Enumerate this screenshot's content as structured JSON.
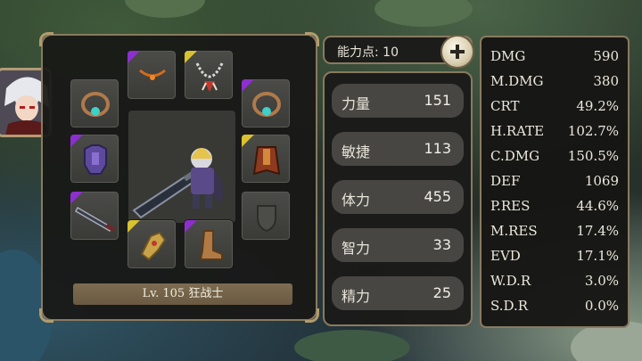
{
  "stat_points": {
    "label": "能力点: 10"
  },
  "equipment": {
    "level_label": "Lv. 105 狂战士",
    "slots": [
      {
        "id": "necklace-orange",
        "rarity": "purple",
        "icon": "amulet-icon"
      },
      {
        "id": "necklace-chain",
        "rarity": "yellow",
        "icon": "necklace-icon"
      },
      {
        "id": "earring-left",
        "rarity": "none",
        "icon": "earring-icon"
      },
      {
        "id": "earring-right",
        "rarity": "purple",
        "icon": "earring-icon"
      },
      {
        "id": "armor",
        "rarity": "purple",
        "icon": "armor-icon"
      },
      {
        "id": "cloak",
        "rarity": "yellow",
        "icon": "cloak-icon"
      },
      {
        "id": "weapon",
        "rarity": "purple",
        "icon": "sword-icon"
      },
      {
        "id": "offhand-empty",
        "rarity": "none",
        "icon": "shield-placeholder-icon"
      },
      {
        "id": "gloves",
        "rarity": "yellow",
        "icon": "gauntlet-icon"
      },
      {
        "id": "boots",
        "rarity": "purple",
        "icon": "boots-icon"
      }
    ]
  },
  "attributes": [
    {
      "name": "力量",
      "value": "151"
    },
    {
      "name": "敏捷",
      "value": "113"
    },
    {
      "name": "体力",
      "value": "455"
    },
    {
      "name": "智力",
      "value": "33"
    },
    {
      "name": "精力",
      "value": "25"
    }
  ],
  "stats": [
    {
      "name": "DMG",
      "value": "590"
    },
    {
      "name": "M.DMG",
      "value": "380"
    },
    {
      "name": "CRT",
      "value": "49.2%"
    },
    {
      "name": "H.RATE",
      "value": "102.7%"
    },
    {
      "name": "C.DMG",
      "value": "150.5%"
    },
    {
      "name": "DEF",
      "value": "1069"
    },
    {
      "name": "P.RES",
      "value": "44.6%"
    },
    {
      "name": "M.RES",
      "value": "17.4%"
    },
    {
      "name": "EVD",
      "value": "17.1%"
    },
    {
      "name": "W.D.R",
      "value": "3.0%"
    },
    {
      "name": "S.D.R",
      "value": "0.0%"
    }
  ],
  "colors": {
    "rarity_purple": "#8d2fd0",
    "rarity_yellow": "#d8c230",
    "panel_border": "#8a7a60"
  }
}
